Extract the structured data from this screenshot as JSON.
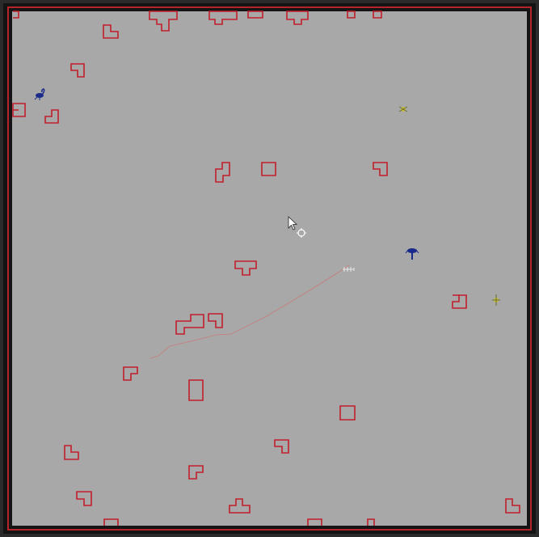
{
  "game": {
    "colors": {
      "background": "#2b2b2b",
      "frame_outer": "#141414",
      "frame_border": "#b3252b",
      "floor": "#a8a8a8",
      "obstacle_outline": "#c21e2c",
      "trail": "#d07070",
      "blue_unit": "#1a2a8a",
      "yellow_unit": "#c8c040",
      "white_unit": "#e8e8e8"
    },
    "obstacle_shape": "polyomino-outline",
    "units": [
      {
        "name": "blue-scorpion",
        "team": "blue",
        "icon": "scorpion-icon"
      },
      {
        "name": "blue-scorpion",
        "team": "blue",
        "icon": "scorpion-icon"
      },
      {
        "name": "yellow-bug",
        "team": "yellow",
        "icon": "bug-icon"
      },
      {
        "name": "yellow-bug",
        "team": "yellow",
        "icon": "bug-icon"
      },
      {
        "name": "white-bug",
        "team": "white",
        "icon": "bug-icon"
      }
    ],
    "cursor": {
      "icon": "arrow-cursor-icon",
      "target_icon": "crosshair-icon"
    }
  }
}
